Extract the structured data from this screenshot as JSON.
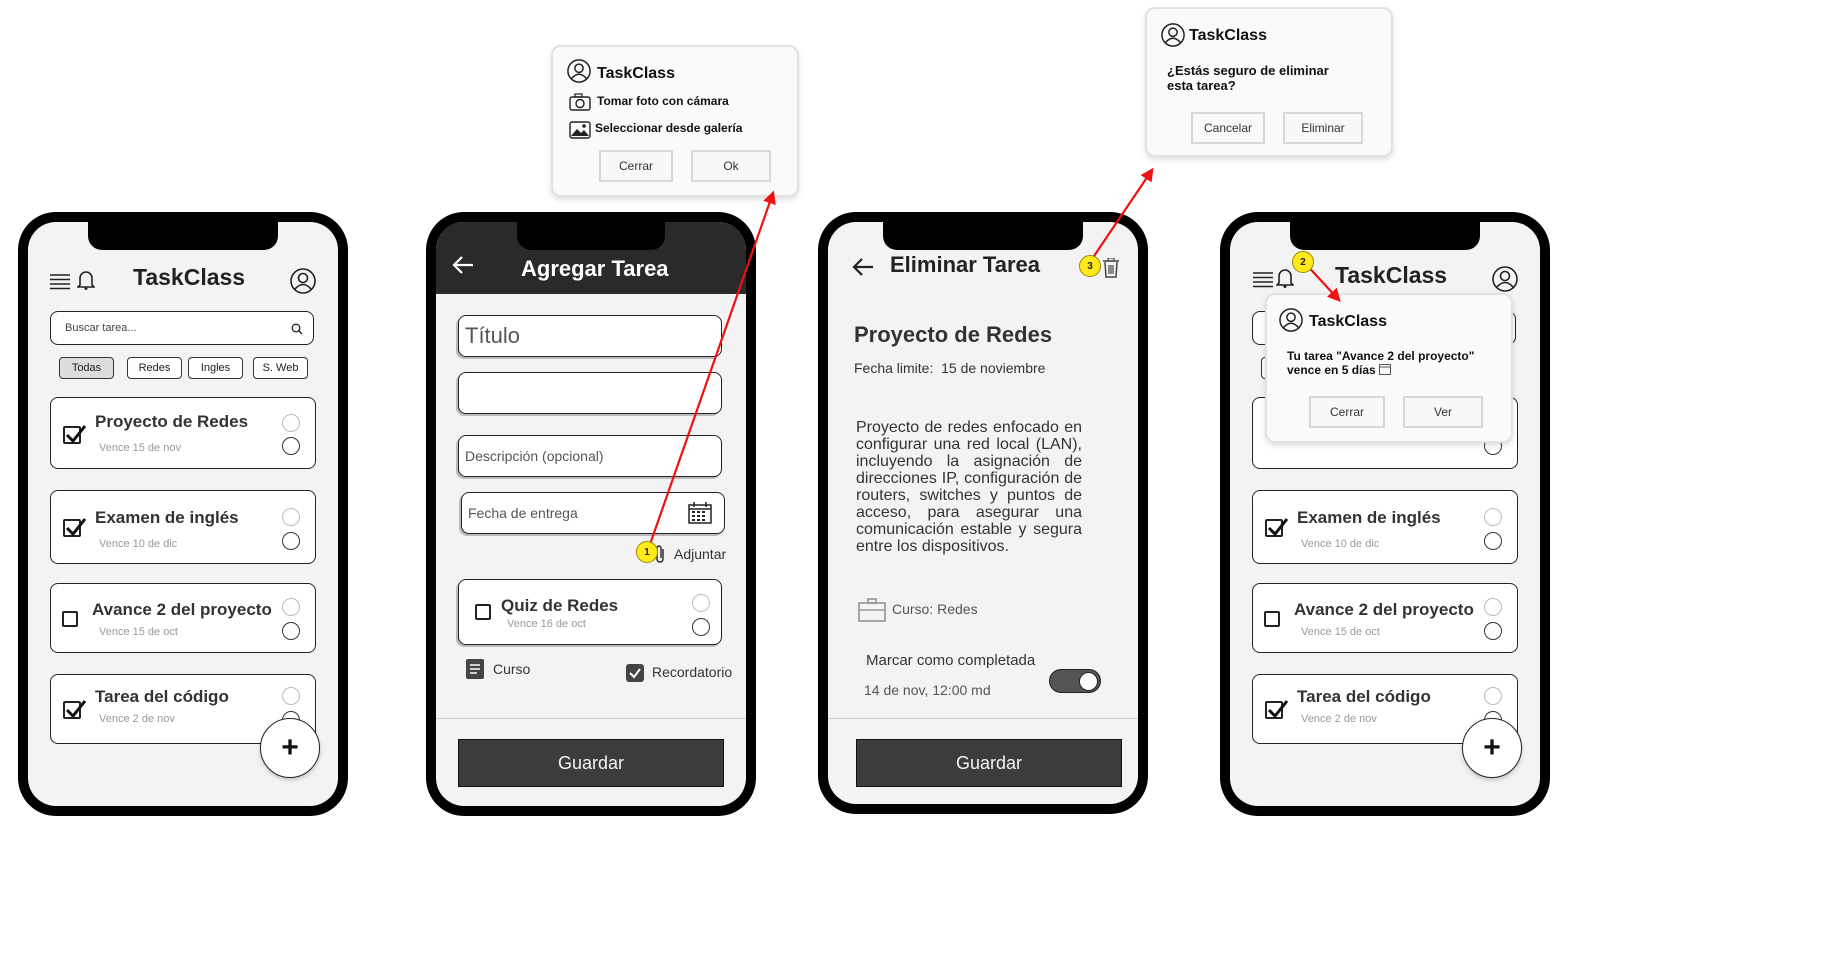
{
  "app_name": "TaskClass",
  "list_screen": {
    "search_placeholder": "Buscar tarea...",
    "filters": [
      "Todas",
      "Redes",
      "Ingles",
      "S. Web"
    ],
    "tasks": [
      {
        "title": "Proyecto de Redes",
        "due": "Vence  15 de nov",
        "checked": true
      },
      {
        "title": "Examen de inglés",
        "due": "Vence  10 de dic",
        "checked": true
      },
      {
        "title": "Avance 2 del proyecto",
        "due": "Vence  15 de oct",
        "checked": false
      },
      {
        "title": "Tarea del código",
        "due": "Vence  2 de nov",
        "checked": true
      }
    ],
    "fab_label": "+"
  },
  "add_screen": {
    "header_title": "Agregar Tarea",
    "title_placeholder": "Título",
    "description_placeholder": "Descripción (opcional)",
    "due_placeholder": "Fecha de entrega",
    "attach_label": "Adjuntar",
    "task_card": {
      "title": "Quiz de Redes",
      "due": "Vence  16 de oct"
    },
    "course_label": "Curso",
    "reminder_label": "Recordatorio",
    "save_label": "Guardar"
  },
  "delete_screen": {
    "header_title": "Eliminar Tarea",
    "task_title": "Proyecto de Redes",
    "deadline": "Fecha limite:  15 de noviembre",
    "description": "Proyecto de redes enfocado en configurar una red local (LAN), incluyendo la asignación de direcciones IP, configuración de routers, switches y puntos de acceso, para asegurar una comunicación estable y segura entre los dispositivos.",
    "course": "Curso: Redes",
    "mark_complete": "Marcar como completada",
    "completed_at": "14 de nov, 12:00 md",
    "save_label": "Guardar"
  },
  "dialogs": {
    "attach": {
      "title": "TaskClass",
      "option_camera": "Tomar foto con cámara",
      "option_gallery": "Seleccionar desde galería",
      "cancel": "Cerrar",
      "ok": "Ok"
    },
    "delete_confirm": {
      "title": "TaskClass",
      "message": "¿Estás seguro de eliminar esta tarea?",
      "cancel": "Cancelar",
      "confirm": "Eliminar"
    },
    "notification": {
      "title": "TaskClass",
      "message": "Tu tarea \"Avance 2 del proyecto\" vence en 5 días",
      "cancel": "Cerrar",
      "view": "Ver"
    }
  },
  "markers": [
    "1",
    "2",
    "3"
  ],
  "colors": {
    "arrow": "#ee1111",
    "marker": "#ffe91a",
    "dark_button": "#3c3c3c"
  }
}
